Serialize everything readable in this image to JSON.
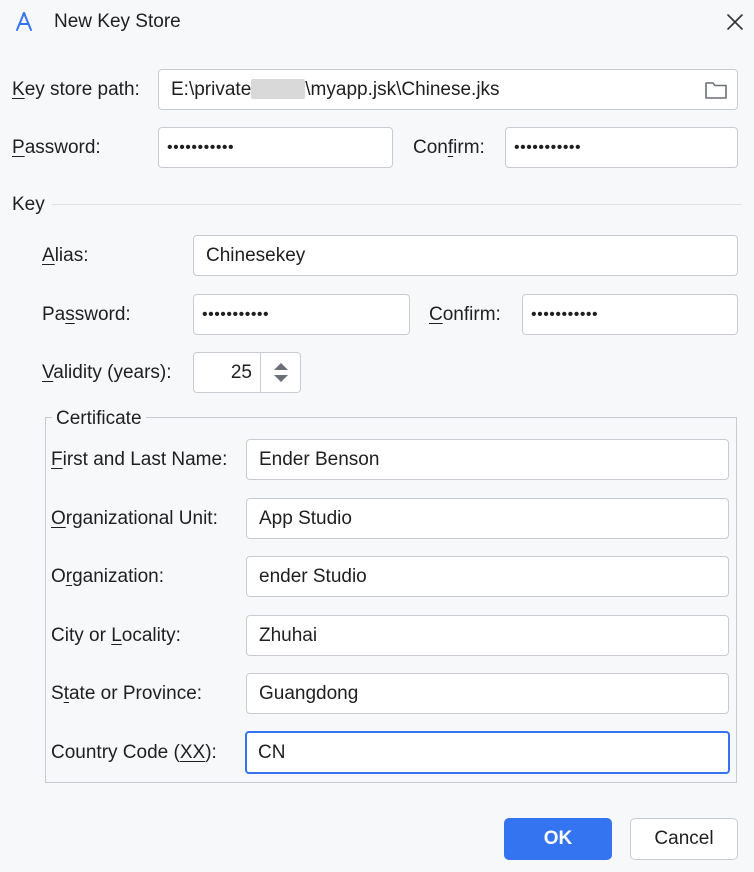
{
  "window": {
    "title": "New Key Store",
    "icon": "app-logo-icon",
    "close_icon": "close-icon"
  },
  "keystore": {
    "path_label_k": "K",
    "path_label_rest": "ey store path:",
    "path_value_prefix": "E:\\private",
    "path_value_suffix": "\\myapp.jsk\\Chinese.jks",
    "folder_icon": "folder-icon",
    "password_label_p": "P",
    "password_label_rest": "assword:",
    "password_value": "•••••••••••",
    "confirm_label_pre": "Con",
    "confirm_label_u": "f",
    "confirm_label_post": "irm:",
    "confirm_value": "•••••••••••"
  },
  "key": {
    "section_label": "Key",
    "alias_label_u": "A",
    "alias_label_rest": "lias:",
    "alias_value": "Chinesekey",
    "password_label_pre": "Pa",
    "password_label_u": "s",
    "password_label_post": "sword:",
    "password_value": "•••••••••••",
    "confirm_label_u": "C",
    "confirm_label_rest": "onfirm:",
    "confirm_value": "•••••••••••",
    "validity_label_u": "V",
    "validity_label_rest": "alidity (years):",
    "validity_value": "25",
    "spinner_icon": "up-down-arrows-icon"
  },
  "certificate": {
    "legend": "Certificate",
    "name_label_u": "F",
    "name_label_rest": "irst and Last Name:",
    "name_value": "Ender Benson",
    "unit_label_u": "O",
    "unit_label_rest": "rganizational Unit:",
    "unit_value": "App Studio",
    "org_label_pre": "O",
    "org_label_u": "r",
    "org_label_post": "ganization:",
    "org_value": "ender Studio",
    "city_label_pre": "City or ",
    "city_label_u": "L",
    "city_label_post": "ocality:",
    "city_value": "Zhuhai",
    "state_label_pre": "S",
    "state_label_u": "t",
    "state_label_post": "ate or Province:",
    "state_value": "Guangdong",
    "country_label_pre": "Country Code (",
    "country_label_u": "XX",
    "country_label_post": "):",
    "country_value": "CN"
  },
  "buttons": {
    "ok": "OK",
    "cancel": "Cancel"
  },
  "colors": {
    "accent": "#3574f0",
    "background": "#f7f8fa",
    "border": "#c8ccd2"
  }
}
